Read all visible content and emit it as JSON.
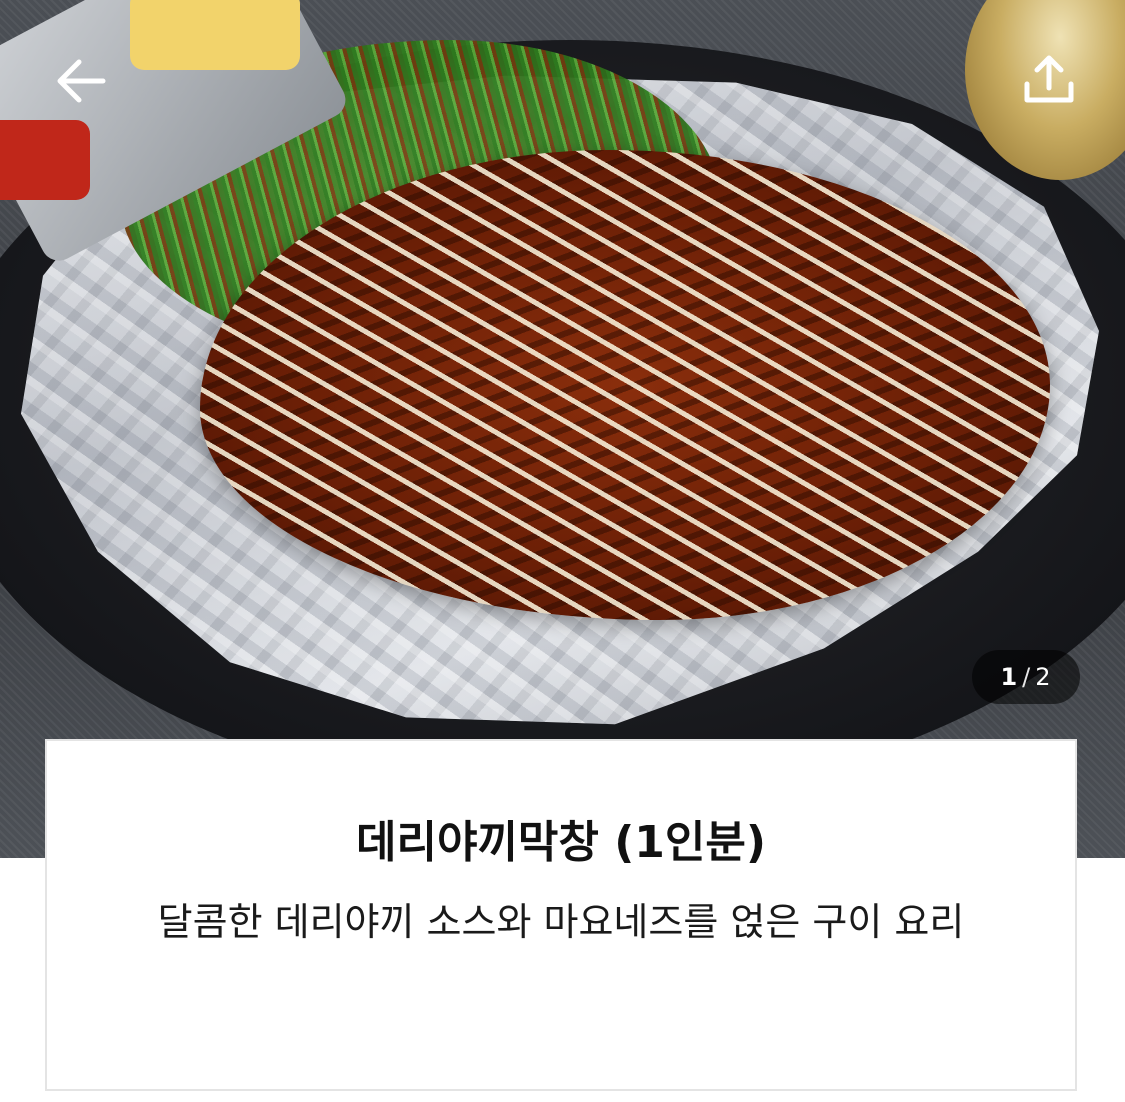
{
  "header": {
    "back_icon": "arrow-left-icon",
    "share_icon": "share-upload-icon"
  },
  "gallery": {
    "current": "1",
    "separator": "/",
    "total": "2"
  },
  "menu_item": {
    "name": "데리야끼막창 (1인분)",
    "description": "달콤한 데리야끼 소스와 마요네즈를 얹은 구이 요리"
  },
  "colors": {
    "card_border": "#e4e4e4",
    "title_text": "#111111",
    "indicator_bg": "#000000"
  }
}
